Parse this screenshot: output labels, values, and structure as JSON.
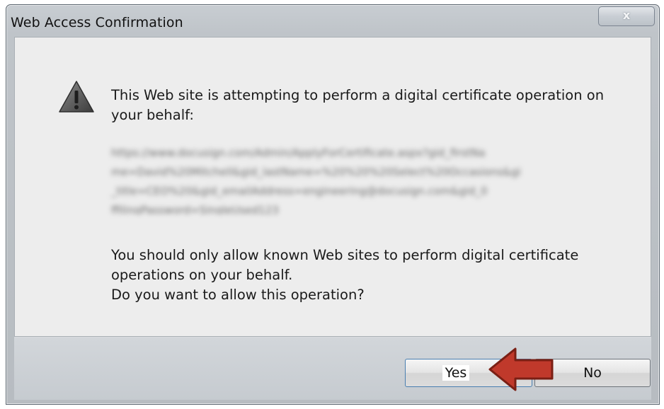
{
  "window": {
    "title": "Web Access Confirmation",
    "close_glyph": "x"
  },
  "message": {
    "line1": "This Web site is attempting to perform a digital certificate operation on",
    "line2": "your behalf:",
    "note_line1": "You should only allow known Web sites to perform digital certificate",
    "note_line2": "operations on your behalf.",
    "question": "Do you want to allow this operation?"
  },
  "url_blurred": [
    "https://www.docusign.com/Admin/ApplyForCertificate.aspx?gid_firstNa",
    "me=David%20Mitchell&gid_lastName=%20%20%20Select%20Occasions&gi",
    "_title=CEO%20&gid_emailAddress=engineering@docusign.com&gid_0",
    "ffilingPassword=SingleUsed123"
  ],
  "buttons": {
    "yes": "Yes",
    "no": "No"
  },
  "icons": {
    "warning": "warning-triangle-icon",
    "pointer": "red-arrow-annotation"
  },
  "colors": {
    "arrow_fill": "#c0392b",
    "arrow_stroke": "#7a1f14"
  }
}
